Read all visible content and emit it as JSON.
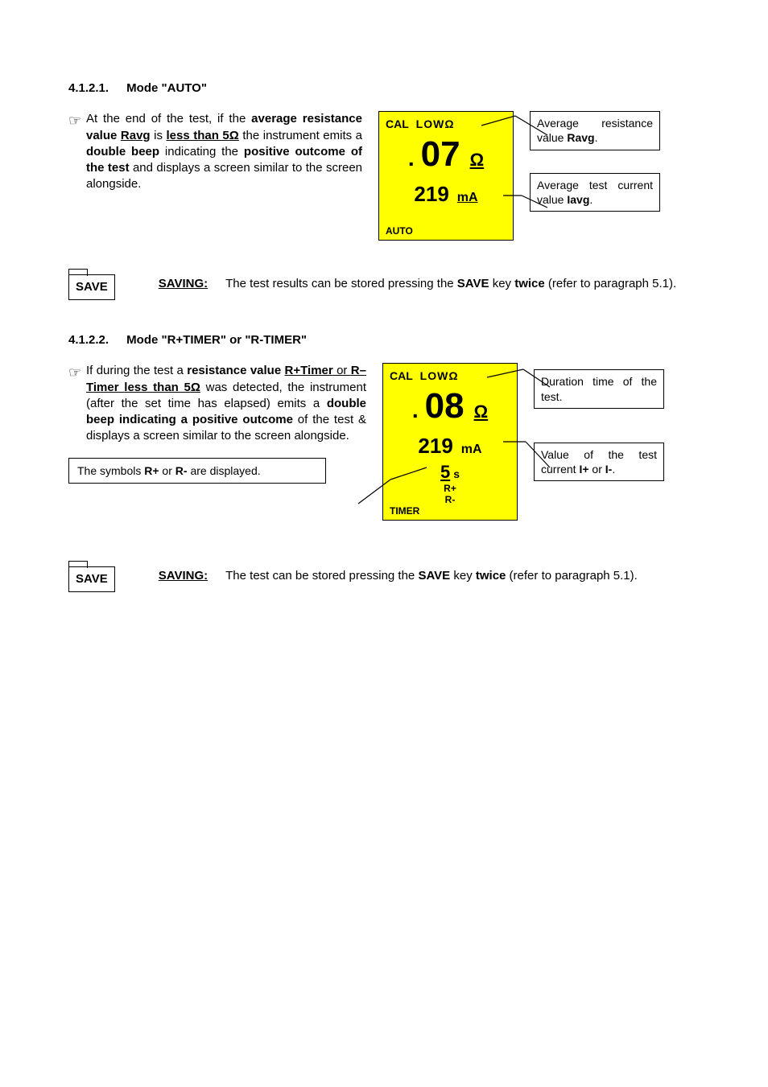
{
  "section1": {
    "heading_num": "4.1.2.1.",
    "heading_title": "Mode \"AUTO\"",
    "body_prefix": "At the end of the test, if the ",
    "body_bold1": "average resistance value ",
    "body_ravg": "Ravg",
    "body_is": " is ",
    "body_less": "less than 5",
    "body_omega": "Ω",
    "body_mid": " the instrument emits a ",
    "body_beep": "double beep",
    "body_indic": " indicating the ",
    "body_positive": "positive outcome of the test",
    "body_tail": " and displays a screen similar to the screen alongside.",
    "lcd": {
      "top_cal": "CAL",
      "top_low": "LOW",
      "top_omega": "Ω",
      "value": "07",
      "value_unit": "Ω",
      "current": "219",
      "current_unit": "mA",
      "mode": "AUTO"
    },
    "callout1_pre": "Average resistance value ",
    "callout1_b": "Ravg",
    "callout1_post": ".",
    "callout2_pre": "Average test current value ",
    "callout2_b": "Iavg",
    "callout2_post": "."
  },
  "save1": {
    "key": "SAVE",
    "label": "SAVING",
    "colon": ":",
    "text_pre": "The test results can be stored pressing the ",
    "text_save": "SAVE",
    "text_mid": " key ",
    "text_twice": "twice",
    "text_post": " (refer to paragraph 5.1)."
  },
  "section2": {
    "heading_num": "4.1.2.2.",
    "heading_title": "Mode \"R+TIMER\" or \"R-TIMER\"",
    "body_prefix": "If during the test a ",
    "body_bold1": "resistance value ",
    "body_rplus": "R+Timer",
    "body_or": " or ",
    "body_rminus": "R–Timer",
    "body_sp": " ",
    "body_less": "less than 5",
    "body_omega": "Ω",
    "body_mid1": " was detected, the instrument (after the set time has elapsed) emits a ",
    "body_beep": "double beep indicating a positive outcome",
    "body_tail": " of the test & displays a screen similar to the screen alongside.",
    "symbols_pre": "The symbols ",
    "symbols_rp": "R+",
    "symbols_or": " or  ",
    "symbols_rm": "R-",
    "symbols_post": " are displayed.",
    "lcd": {
      "top_cal": "CAL",
      "top_low": "LOW",
      "top_omega": "Ω",
      "value": "08",
      "value_unit": "Ω",
      "current": "219",
      "current_unit": "mA",
      "time": "5",
      "time_unit": "s",
      "rplus": "R+",
      "rminus": "R-",
      "mode": "TIMER"
    },
    "callout1": "Duration time of the test.",
    "callout2_pre": "Value of the test current ",
    "callout2_ip": "I+",
    "callout2_or": " or ",
    "callout2_im": "I-",
    "callout2_post": "."
  },
  "save2": {
    "key": "SAVE",
    "label": "SAVING",
    "colon": ":",
    "text_pre": "The test can be stored pressing the ",
    "text_save": "SAVE",
    "text_mid": " key ",
    "text_twice": "twice",
    "text_post": " (refer to paragraph 5.1)."
  },
  "hand_glyph": "☞"
}
